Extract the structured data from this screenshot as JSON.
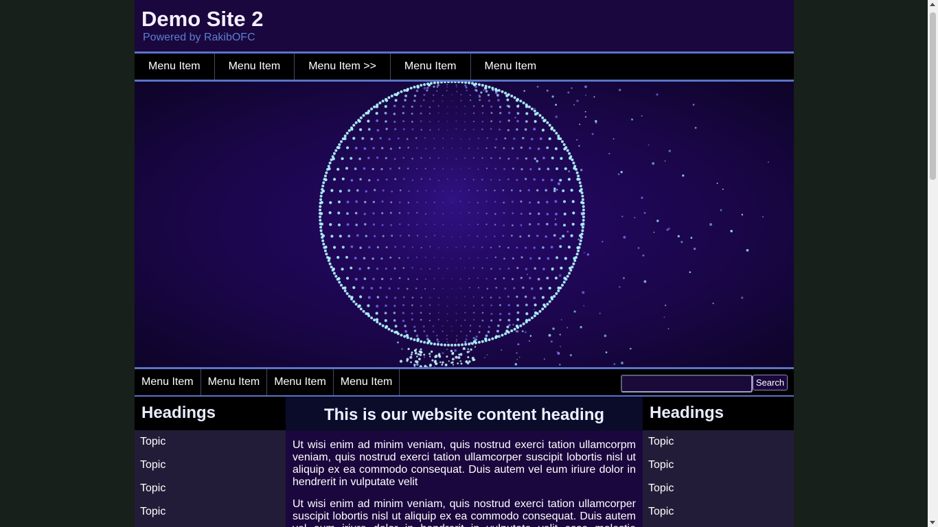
{
  "site": {
    "title": "Demo Site 2",
    "subtitle": "Powered by RakibOFC"
  },
  "top_nav": {
    "items": [
      "Menu Item",
      "Menu Item",
      "Menu Item >>",
      "Menu Item",
      "Menu Item"
    ]
  },
  "banner": {
    "image_name": "particle-globe-banner"
  },
  "sub_nav": {
    "items": [
      "Menu Item",
      "Menu Item",
      "Menu Item",
      "Menu Item"
    ],
    "search_value": "",
    "search_button": "Search"
  },
  "left_sidebar": {
    "heading": "Headings",
    "topics": [
      "Topic",
      "Topic",
      "Topic",
      "Topic"
    ]
  },
  "right_sidebar": {
    "heading": "Headings",
    "topics": [
      "Topic",
      "Topic",
      "Topic",
      "Topic"
    ]
  },
  "content": {
    "heading": "This is our website content heading",
    "paragraphs": [
      "Ut wisi enim ad minim veniam, quis nostrud exerci tation ullamcorpm veniam, quis nostrud exerci tation ullamcorper suscipit lobortis nisl ut aliquip ex ea commodo consequat. Duis autem vel eum iriure dolor in hendrerit in vulputate velit",
      "Ut wisi enim ad minim veniam, quis nostrud exerci tation ullamcorper suscipit lobortis nisl ut aliquip ex ea commodo consequat. Duis autem vel eum iriure dolor in hendrerit in vulputate velit esse molestie consequat, vel illum dolore"
    ]
  },
  "colors": {
    "page_bg": "#17201a",
    "header_bg": "#1a073d",
    "nav_bg": "#000000",
    "nav_border": "#5a74c8",
    "subtitle": "#5b7fd3",
    "globe_glow": "#8ff0ff"
  }
}
